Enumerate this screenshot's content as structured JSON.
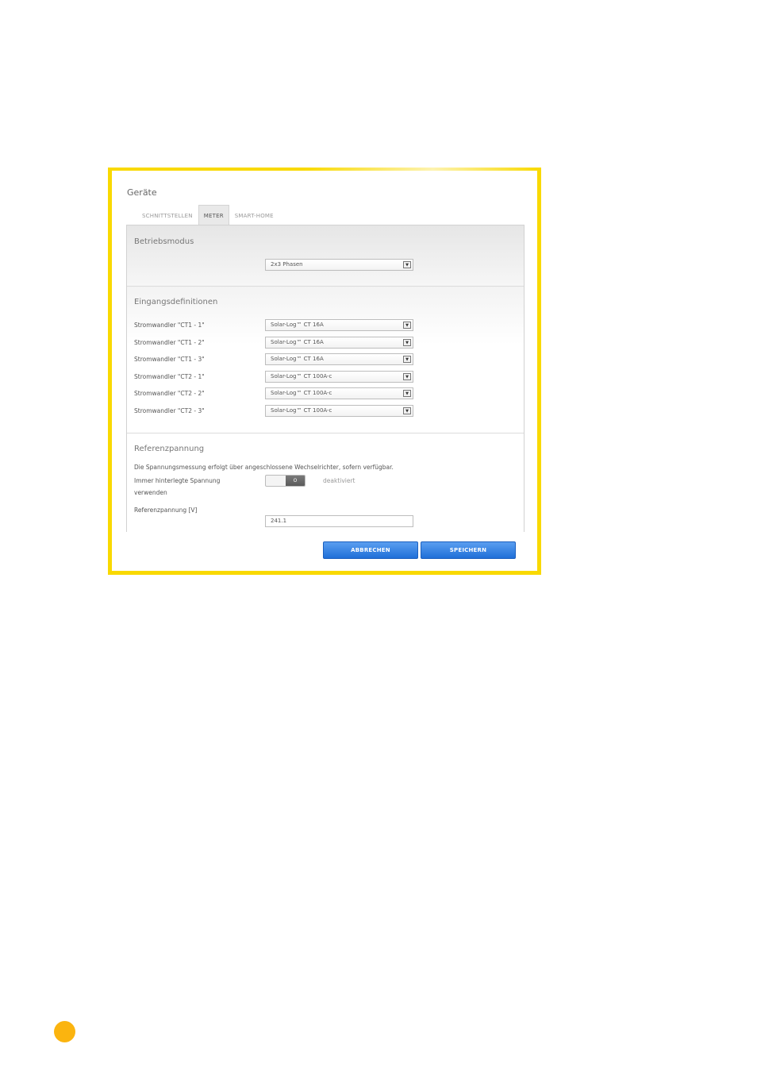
{
  "window": {
    "title": "Geräte"
  },
  "tabs": [
    {
      "label": "SCHNITTSTELLEN",
      "active": false
    },
    {
      "label": "METER",
      "active": true
    },
    {
      "label": "SMART-HOME",
      "active": false
    }
  ],
  "betriebsmodus": {
    "title": "Betriebsmodus",
    "mode_value": "2x3 Phasen"
  },
  "eingang": {
    "title": "Eingangsdefinitionen",
    "rows": [
      {
        "label": "Stromwandler \"CT1 - 1\"",
        "value": "Solar-Log™ CT 16A"
      },
      {
        "label": "Stromwandler \"CT1 - 2\"",
        "value": "Solar-Log™ CT 16A"
      },
      {
        "label": "Stromwandler \"CT1 - 3\"",
        "value": "Solar-Log™ CT 16A"
      },
      {
        "label": "Stromwandler \"CT2 - 1\"",
        "value": "Solar-Log™ CT 100A-c"
      },
      {
        "label": "Stromwandler \"CT2 - 2\"",
        "value": "Solar-Log™ CT 100A-c"
      },
      {
        "label": "Stromwandler \"CT2 - 3\"",
        "value": "Solar-Log™ CT 100A-c"
      }
    ]
  },
  "referenz": {
    "title": "Referenzpannung",
    "note": "Die Spannungsmessung erfolgt über angeschlossene Wechselrichter, sofern verfügbar.",
    "toggle_label_line1": "Immer hinterlegte Spannung",
    "toggle_label_line2": "verwenden",
    "toggle_knob": "O",
    "toggle_state": "deaktiviert",
    "voltage_label": "Referenzpannung [V]",
    "voltage_value": "241.1"
  },
  "buttons": {
    "cancel": "ABBRECHEN",
    "save": "SPEICHERN"
  },
  "colors": {
    "frame": "#f9d900",
    "button": "#1f6fd8",
    "page_marker": "#fbb40f"
  },
  "icons": {
    "select_arrow": "▼"
  }
}
